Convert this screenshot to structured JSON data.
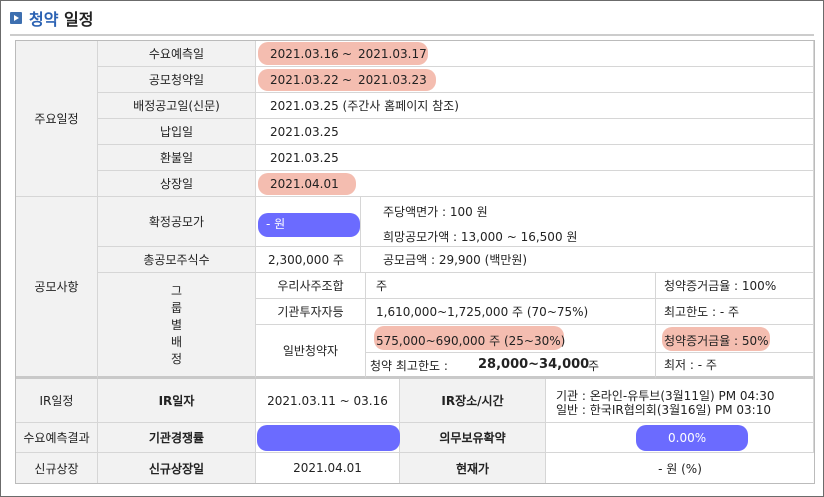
{
  "title": {
    "accent": "청약",
    "rest": " 일정"
  },
  "schedule": {
    "section_label": "주요일정",
    "rows": [
      {
        "label": "수요예측일",
        "start": "2021.03.16",
        "sep": "~",
        "end": "2021.03.17"
      },
      {
        "label": "공모청약일",
        "start": "2021.03.22",
        "sep": "~",
        "end": "2021.03.23"
      },
      {
        "label": "배정공고일(신문)",
        "value": "2021.03.25 (주간사 홈페이지 참조)"
      },
      {
        "label": "납입일",
        "value": "2021.03.25"
      },
      {
        "label": "환불일",
        "value": "2021.03.25"
      },
      {
        "label": "상장일",
        "value": "2021.04.01"
      }
    ]
  },
  "offering": {
    "section_label": "공모사항",
    "final_price_label": "확정공모가",
    "final_price_value": "- 원",
    "par_value": "주당액면가 : 100 원",
    "desired_price": "희망공모가액 : 13,000 ~ 16,500 원",
    "total_shares_label": "총공모주식수",
    "total_shares_value": "2,300,000 주",
    "total_amount": "공모금액 : 29,900 (백만원)",
    "group_label_chars": [
      "그",
      "룹",
      "별",
      "배",
      "정"
    ],
    "groups": [
      {
        "label": "우리사주조합",
        "value": "주",
        "right": "청약증거금율 : 100%"
      },
      {
        "label": "기관투자자등",
        "value": "1,610,000~1,725,000 주 (70~75%)",
        "right": "최고한도 : - 주"
      },
      {
        "label": "일반청약자",
        "value": "575,000~690,000 주 (25~30%)",
        "right": "청약증거금율 : 50%",
        "limit_label": "청약 최고한도 :",
        "limit_value": "28,000~34,000",
        "limit_unit": "주",
        "min": "최저 : - 주"
      }
    ]
  },
  "ir": {
    "section_label": "IR일정",
    "date_label": "IR일자",
    "date_value": "2021.03.11 ~ 03.16",
    "place_label": "IR장소/시간",
    "place_line1": "기관 : 온라인-유투브(3월11일) PM 04:30",
    "place_line2": "일반 : 한국IR협의회(3월16일) PM 03:10"
  },
  "forecast": {
    "section_label": "수요예측결과",
    "competition_label": "기관경쟁률",
    "competition_value": "",
    "lockup_label": "의무보유확약",
    "lockup_value": "0.00%"
  },
  "listing": {
    "section_label": "신규상장",
    "date_label": "신규상장일",
    "date_value": "2021.04.01",
    "price_label": "현재가",
    "price_value": "- 원 (%)"
  },
  "colors": {
    "accent": "#2b62b3",
    "highlight_pink": "#f4bdb0",
    "highlight_blue": "#6b6bff",
    "label_bg": "#f2f2f2"
  }
}
